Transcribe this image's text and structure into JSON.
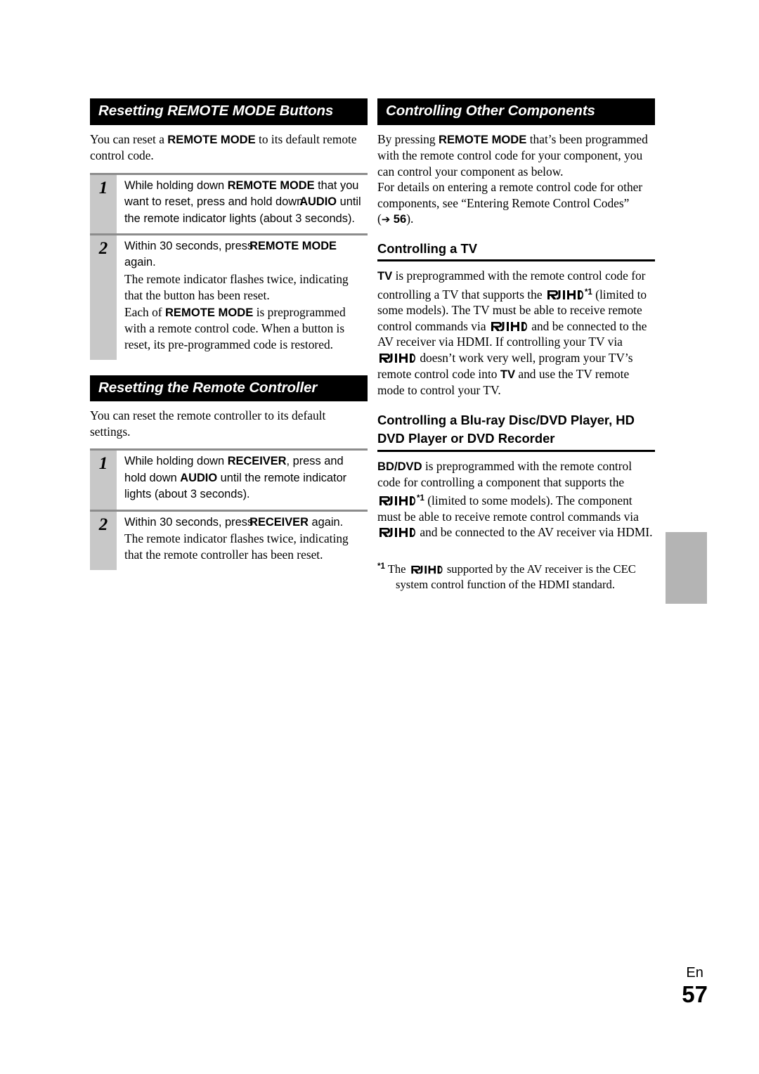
{
  "page": {
    "language_label": "En",
    "page_number": "57"
  },
  "logo": {
    "name": "rihd-logo",
    "text": "RIHD"
  },
  "left_column": {
    "section1": {
      "heading": "Resetting REMOTE MODE Buttons",
      "intro_1": "You can reset a ",
      "intro_bold": "REMOTE MODE",
      "intro_2": " to its default remote control code.",
      "steps": [
        {
          "number": "1",
          "line1_a": "While holding down ",
          "line1_bold": "REMOTE MODE",
          "line1_b": " that you want to reset, press and hold down",
          "line1_bold2": "AUDIO",
          "line1_c": " until the remote indicator lights (about 3 seconds)."
        },
        {
          "number": "2",
          "line1_a": "Within 30 seconds, press",
          "line1_bold": "REMOTE MODE",
          "line1_b": " again.",
          "para1": "The remote indicator flashes twice, indicating that the button has been reset.",
          "para2_a": "Each of ",
          "para2_bold": "REMOTE MODE",
          "para2_b": " is preprogrammed with a remote control code. When a button is reset, its pre-programmed code is restored."
        }
      ]
    },
    "section2": {
      "heading": "Resetting the Remote Controller",
      "intro": "You can reset the remote controller to its default settings.",
      "steps": [
        {
          "number": "1",
          "line1_a": "While holding down ",
          "line1_bold": "RECEIVER",
          "line1_b": ", press and hold down ",
          "line1_bold2": "AUDIO",
          "line1_c": " until the remote indicator lights (about 3 seconds)."
        },
        {
          "number": "2",
          "line1_a": "Within 30 seconds, press",
          "line1_bold": "RECEIVER",
          "line1_b": " again.",
          "para1": "The remote indicator flashes twice, indicating that the remote controller has been reset."
        }
      ]
    }
  },
  "right_column": {
    "heading": "Controlling Other Components",
    "intro_1_a": "By pressing ",
    "intro_1_bold": "REMOTE MODE",
    "intro_1_b": " that’s been programmed with the remote control code for your component, you can control your component as below.",
    "intro_2": "For details on entering a remote control code for other components, see “Entering Remote Control Codes”",
    "intro_2_ref_open": "(",
    "intro_2_arrow": "➔",
    "intro_2_page": "56",
    "intro_2_ref_close": ").",
    "tv": {
      "subheading": "Controlling a TV",
      "t1_bold": "TV",
      "t1": " is preprogrammed with the remote control code for controlling a TV that supports the ",
      "t1_ref": "*1",
      "t2": " (limited to some models). The TV must be able to receive remote control commands via ",
      "t3": " and be connected to the AV receiver via HDMI. If controlling your TV via ",
      "t4": " doesn’t work very well, program your TV’s remote control code into ",
      "t4_bold": "TV",
      "t5": " and use the TV remote mode to control your TV."
    },
    "bd": {
      "subheading_line1": "Controlling a Blu-ray Disc/DVD Player, HD",
      "subheading_line2": "DVD Player or DVD Recorder",
      "b1_bold": "BD/DVD",
      "b1": " is preprogrammed with the remote control code for controlling a component that supports the ",
      "b1_ref": "*1",
      "b2": " (limited to some models). The component must be able to receive remote control commands via ",
      "b3": " and be connected to the AV receiver via HDMI."
    },
    "footnote": {
      "marker": "*1",
      "f1": " The ",
      "f2": " supported by the AV receiver is the CEC system control function of the HDMI standard."
    }
  },
  "colors": {
    "heading_bar_bg": "#000000",
    "heading_bar_text": "#ffffff",
    "step_number_bg": "#c8c8c8",
    "rule_gray": "#8c8c8c",
    "side_tab": "#b4b4b4",
    "text": "#000000"
  }
}
